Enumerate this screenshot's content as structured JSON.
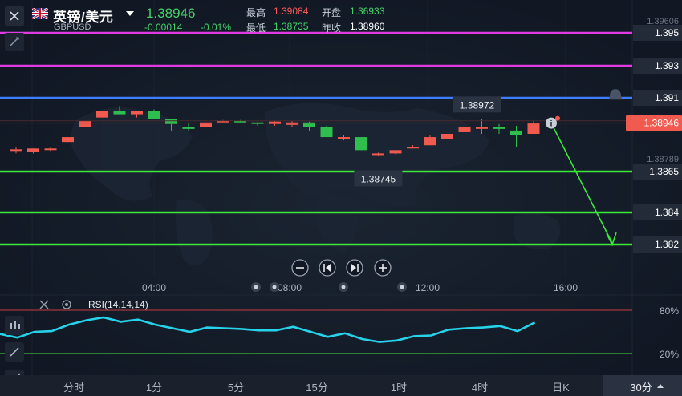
{
  "header": {
    "pair_name": "英镑/美元",
    "pair_code": "GBPUSD",
    "last_price": "1.38946",
    "change": "-0.00014",
    "change_pct": "-0.01%",
    "high_label": "最高",
    "high_value": "1.39084",
    "open_label": "开盘",
    "open_value": "1.36933",
    "low_label": "最低",
    "low_value": "1.38735",
    "prev_close_label": "昨收",
    "prev_close_value": "1.38960"
  },
  "colors": {
    "up": "#f05a4f",
    "down": "#2fbf4f",
    "magenta_line": "#e03ae3",
    "blue_line": "#3f7dff",
    "green_line": "#3ce83c",
    "rsi_line": "#27d3ea",
    "last_price_bg": "#f05a4f"
  },
  "price_axis": {
    "top_tick": "1.39606",
    "bottom_tick": "1.38789",
    "current_price_tag": "1.38946"
  },
  "drawn_lines": [
    {
      "label": "1.395",
      "color": "#e03ae3"
    },
    {
      "label": "1.393",
      "color": "#e03ae3"
    },
    {
      "label": "1.391",
      "color": "#3f7dff"
    },
    {
      "label": "1.3865",
      "color": "#3ce83c"
    },
    {
      "label": "1.384",
      "color": "#3ce83c"
    },
    {
      "label": "1.382",
      "color": "#3ce83c"
    }
  ],
  "callouts": {
    "high_marker": "1.38972",
    "low_marker": "1.38745"
  },
  "time_axis": [
    "04:00",
    "08:00",
    "12:00",
    "16:00"
  ],
  "nav_icons": [
    "zoom-out-icon",
    "step-back-icon",
    "step-forward-icon",
    "zoom-in-icon"
  ],
  "rsi": {
    "label": "RSI(14,14,14)",
    "level_high": "80%",
    "level_low": "20%"
  },
  "timeframes": [
    "分时",
    "1分",
    "5分",
    "15分",
    "1时",
    "4时",
    "日K",
    "30分"
  ],
  "active_timeframe": "30分",
  "chart_data": {
    "type": "candlestick",
    "series": [
      {
        "name": "GBPUSD 30分",
        "candles": [
          {
            "o": 1.38785,
            "h": 1.388,
            "l": 1.3876,
            "c": 1.38785
          },
          {
            "o": 1.3877,
            "h": 1.3879,
            "l": 1.3876,
            "c": 1.3879
          },
          {
            "o": 1.3879,
            "h": 1.38795,
            "l": 1.38775,
            "c": 1.3879
          },
          {
            "o": 1.3883,
            "h": 1.3886,
            "l": 1.3883,
            "c": 1.3886
          },
          {
            "o": 1.3892,
            "h": 1.3896,
            "l": 1.3892,
            "c": 1.3896
          },
          {
            "o": 1.3898,
            "h": 1.3902,
            "l": 1.3898,
            "c": 1.3902
          },
          {
            "o": 1.3902,
            "h": 1.3905,
            "l": 1.39,
            "c": 1.39
          },
          {
            "o": 1.39,
            "h": 1.3902,
            "l": 1.3898,
            "c": 1.3902
          },
          {
            "o": 1.3902,
            "h": 1.3903,
            "l": 1.3897,
            "c": 1.3897
          },
          {
            "o": 1.3897,
            "h": 1.3897,
            "l": 1.389,
            "c": 1.3894
          },
          {
            "o": 1.3892,
            "h": 1.3895,
            "l": 1.389,
            "c": 1.3891
          },
          {
            "o": 1.3892,
            "h": 1.3895,
            "l": 1.3892,
            "c": 1.3895
          },
          {
            "o": 1.3896,
            "h": 1.38965,
            "l": 1.38955,
            "c": 1.3896
          },
          {
            "o": 1.3896,
            "h": 1.38965,
            "l": 1.3895,
            "c": 1.38955
          },
          {
            "o": 1.3895,
            "h": 1.3895,
            "l": 1.3893,
            "c": 1.38945
          },
          {
            "o": 1.3894,
            "h": 1.3896,
            "l": 1.3893,
            "c": 1.38955
          },
          {
            "o": 1.38935,
            "h": 1.3896,
            "l": 1.3892,
            "c": 1.3895
          },
          {
            "o": 1.3895,
            "h": 1.38955,
            "l": 1.389,
            "c": 1.3892
          },
          {
            "o": 1.3892,
            "h": 1.3893,
            "l": 1.3886,
            "c": 1.3886
          },
          {
            "o": 1.3885,
            "h": 1.3887,
            "l": 1.3884,
            "c": 1.3886
          },
          {
            "o": 1.3886,
            "h": 1.3886,
            "l": 1.3878,
            "c": 1.3878
          },
          {
            "o": 1.3875,
            "h": 1.38765,
            "l": 1.38745,
            "c": 1.3876
          },
          {
            "o": 1.3876,
            "h": 1.3878,
            "l": 1.38755,
            "c": 1.3878
          },
          {
            "o": 1.388,
            "h": 1.3881,
            "l": 1.3879,
            "c": 1.388
          },
          {
            "o": 1.3881,
            "h": 1.3887,
            "l": 1.3881,
            "c": 1.3886
          },
          {
            "o": 1.3885,
            "h": 1.3888,
            "l": 1.3885,
            "c": 1.3888
          },
          {
            "o": 1.3889,
            "h": 1.3892,
            "l": 1.3889,
            "c": 1.3892
          },
          {
            "o": 1.3892,
            "h": 1.38972,
            "l": 1.3888,
            "c": 1.3892
          },
          {
            "o": 1.3892,
            "h": 1.3894,
            "l": 1.3888,
            "c": 1.3891
          },
          {
            "o": 1.389,
            "h": 1.3893,
            "l": 1.388,
            "c": 1.3887
          },
          {
            "o": 1.3888,
            "h": 1.3896,
            "l": 1.3888,
            "c": 1.38946
          }
        ]
      }
    ],
    "ylim": [
      1.37995,
      1.39701
    ],
    "price_lines": [
      1.395,
      1.393,
      1.391,
      1.3865,
      1.384,
      1.382
    ],
    "forecast": {
      "from": 1.38946,
      "to": 1.382
    },
    "x_ticks": [
      "04:00",
      "08:00",
      "12:00",
      "16:00"
    ],
    "grid": true,
    "rsi": {
      "name": "RSI(14,14,14)",
      "ylim": [
        0,
        100
      ],
      "levels": [
        80,
        20
      ],
      "values": [
        47,
        42,
        50,
        51,
        60,
        66,
        70,
        64,
        67,
        60,
        55,
        50,
        56,
        55,
        54,
        52,
        52,
        57,
        50,
        43,
        48,
        40,
        36,
        38,
        44,
        45,
        53,
        55,
        56,
        58,
        51,
        63
      ]
    }
  }
}
